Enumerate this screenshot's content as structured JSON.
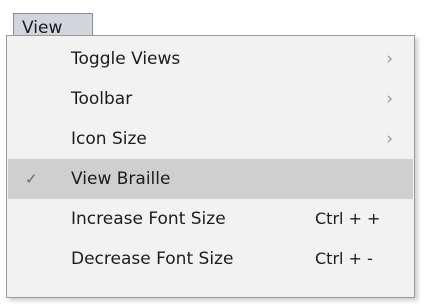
{
  "menubar": {
    "view_label": "View"
  },
  "menu": {
    "items": [
      {
        "label": "Toggle Views",
        "submenu_icon": "›"
      },
      {
        "label": "Toolbar",
        "submenu_icon": "›"
      },
      {
        "label": "Icon Size",
        "submenu_icon": "›"
      },
      {
        "label": "View Braille",
        "check_icon": "✓",
        "checked": true,
        "highlighted": true
      },
      {
        "label": "Increase Font Size",
        "shortcut": "Ctrl + +"
      },
      {
        "label": "Decrease Font Size",
        "shortcut": "Ctrl + -"
      }
    ]
  },
  "colors": {
    "menu_background": "#f2f2f2",
    "highlight": "#cfcfcf",
    "menubar_selected": "#d2d6dc"
  }
}
